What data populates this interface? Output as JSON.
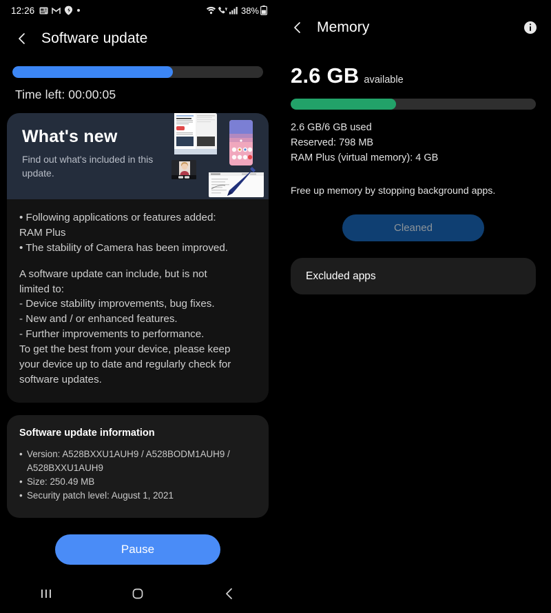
{
  "left_panel": {
    "statusbar": {
      "time": "12:26",
      "battery_text": "38%",
      "icons": [
        "news-icon",
        "gmail-icon",
        "app-icon",
        "dot-icon"
      ],
      "right_icons": [
        "wifi-icon",
        "volte-call-icon",
        "signal-bars-icon",
        "battery-icon"
      ]
    },
    "appbar": {
      "title": "Software update",
      "back_icon": "chevron-left-icon"
    },
    "progress": {
      "percent": 64,
      "fill_color": "#3c86f5",
      "track_color": "#2e2e2e",
      "time_left_label": "Time left: 00:00:05"
    },
    "whats_new": {
      "title": "What's new",
      "subtitle": "Find out what's included in this update.",
      "bg_color": "#242d3c"
    },
    "release_notes": [
      "• Following applications or features added:",
      "RAM Plus",
      "• The stability of Camera has been improved.",
      "",
      "A software update can include, but is not",
      "limited to:",
      " - Device stability improvements, bug fixes.",
      " - New and / or enhanced features.",
      " - Further improvements to performance.",
      "To get the best from your device, please keep",
      "your device up to date and regularly check for",
      "software updates."
    ],
    "update_info": {
      "heading": "Software update information",
      "version_line_1": "Version: A528BXXU1AUH9 / A528BODM1AUH9 /",
      "version_line_2": "A528BXXU1AUH9",
      "size_line": "Size: 250.49 MB",
      "security_line": "Security patch level: August 1, 2021"
    },
    "pause_button": {
      "label": "Pause",
      "color": "#4a8cf7"
    },
    "navbar": {
      "recents_icon": "recents-icon",
      "home_icon": "home-icon",
      "back_icon": "back-icon"
    }
  },
  "right_panel": {
    "appbar": {
      "title": "Memory",
      "back_icon": "chevron-left-icon",
      "info_icon": "info-icon"
    },
    "memory": {
      "available_value": "2.6 GB",
      "available_label": "available",
      "percent": 43,
      "fill_color": "#22a269",
      "track_color": "#2f2f2f",
      "used_line": "2.6 GB/6 GB used",
      "reserved_line": "Reserved: 798 MB",
      "ram_plus_line": "RAM Plus (virtual memory): 4 GB",
      "hint": "Free up memory by stopping background apps."
    },
    "cleaned_button": {
      "label": "Cleaned",
      "bg_color": "#0f3f72",
      "text_color": "#8d9499"
    },
    "excluded_apps": {
      "label": "Excluded apps"
    }
  }
}
